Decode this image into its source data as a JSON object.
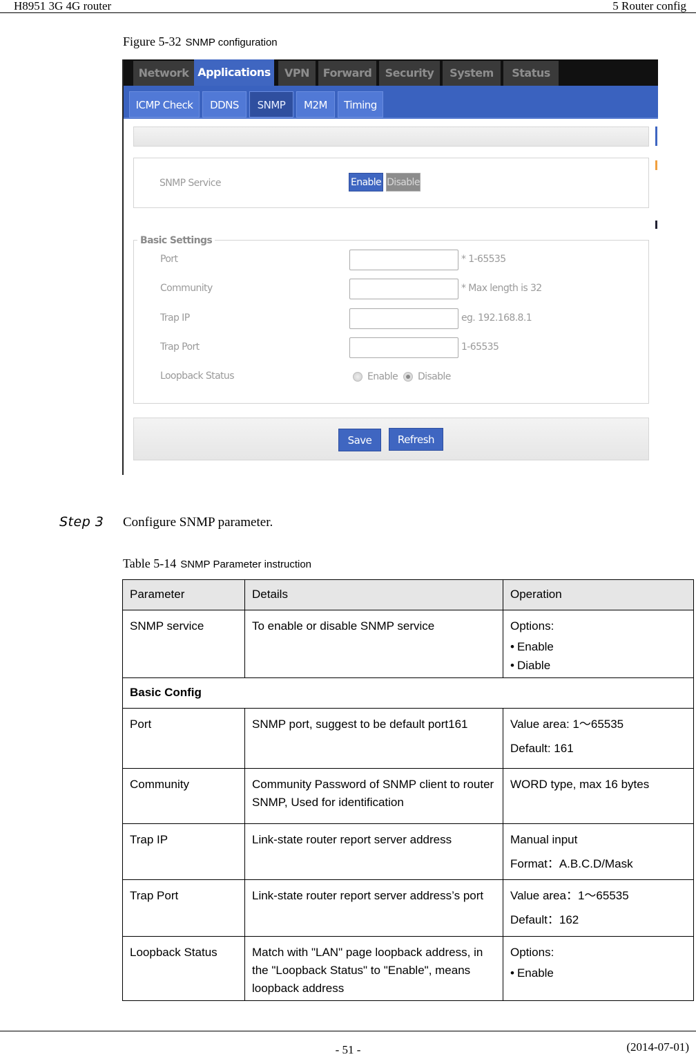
{
  "header": {
    "left": "H8951 3G 4G router",
    "right": "5  Router config"
  },
  "figure_caption": {
    "number": "Figure 5-32",
    "title": "SNMP configuration"
  },
  "screenshot": {
    "main_tabs": [
      {
        "label": "Network",
        "active": false
      },
      {
        "label": "Applications",
        "active": true
      },
      {
        "label": "VPN",
        "active": false
      },
      {
        "label": "Forward",
        "active": false
      },
      {
        "label": "Security",
        "active": false
      },
      {
        "label": "System",
        "active": false
      },
      {
        "label": "Status",
        "active": false
      }
    ],
    "sub_tabs": [
      {
        "label": "ICMP Check",
        "active": false
      },
      {
        "label": "DDNS",
        "active": false
      },
      {
        "label": "SNMP",
        "active": true
      },
      {
        "label": "M2M",
        "active": false
      },
      {
        "label": "Timing",
        "active": false
      }
    ],
    "snmp_service": {
      "label": "SNMP Service",
      "enable_label": "Enable",
      "disable_label": "Disable",
      "selected": "Enable"
    },
    "basic_settings": {
      "title": "Basic Settings",
      "fields": [
        {
          "label": "Port",
          "value": "",
          "hint": "* 1-65535"
        },
        {
          "label": "Community",
          "value": "",
          "hint": "* Max length is 32"
        },
        {
          "label": "Trap IP",
          "value": "",
          "hint": "eg. 192.168.8.1"
        },
        {
          "label": "Trap Port",
          "value": "",
          "hint": "1-65535"
        }
      ],
      "loopback": {
        "label": "Loopback Status",
        "options": [
          "Enable",
          "Disable"
        ],
        "selected": "Disable"
      }
    },
    "buttons": {
      "save": "Save",
      "refresh": "Refresh"
    },
    "colors": {
      "accent_blue": "#3f66c1",
      "tab_dark": "#3a3a3a",
      "sub_bar": "#3a62bf"
    }
  },
  "step": {
    "label": "Step 3",
    "text": "Configure SNMP parameter."
  },
  "table_caption": {
    "number": "Table 5-14",
    "title": "SNMP Parameter instruction"
  },
  "table": {
    "headers": [
      "Parameter",
      "Details",
      "Operation"
    ],
    "rows": [
      {
        "parameter": "SNMP service",
        "details": "To enable or disable SNMP service",
        "operation_label": "Options:",
        "bullets": [
          "Enable",
          "Diable"
        ]
      },
      {
        "section": "Basic Config"
      },
      {
        "parameter": "Port",
        "details": "SNMP port, suggest to be default port161",
        "lines": [
          "Value area: 1～65535",
          "Default: 161"
        ]
      },
      {
        "parameter": "Community",
        "details": "Community Password of SNMP client to router SNMP, Used for identification",
        "lines": [
          "WORD type, max 16 bytes"
        ]
      },
      {
        "parameter": "Trap IP",
        "details": "Link-state router report server address",
        "lines": [
          "Manual input",
          "Format：A.B.C.D/Mask"
        ]
      },
      {
        "parameter": "Trap Port",
        "details": "Link-state router report server address’s port",
        "lines": [
          "Value area：1～65535",
          "Default：162"
        ]
      },
      {
        "parameter": "Loopback Status",
        "details": "Match with \"LAN\" page loopback address, in the \"Loopback Status\" to \"Enable\", means loopback address",
        "operation_label": "Options:",
        "bullets": [
          "Enable"
        ]
      }
    ]
  },
  "footer": {
    "page_number": "- 51 -",
    "date": "(2014-07-01)"
  }
}
